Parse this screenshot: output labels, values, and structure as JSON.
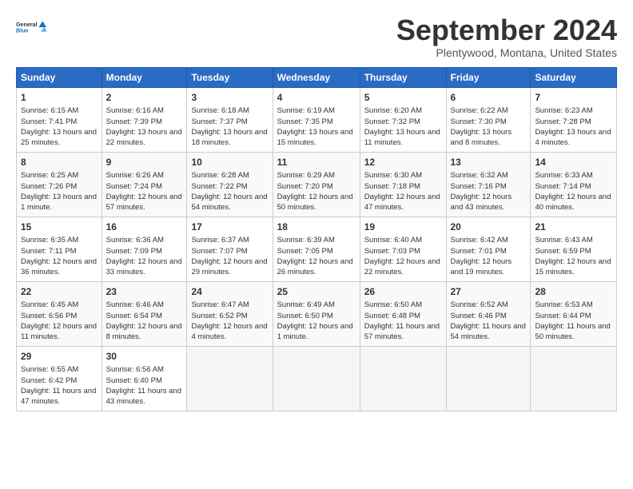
{
  "logo": {
    "general": "General",
    "blue": "Blue"
  },
  "header": {
    "month": "September 2024",
    "location": "Plentywood, Montana, United States"
  },
  "weekdays": [
    "Sunday",
    "Monday",
    "Tuesday",
    "Wednesday",
    "Thursday",
    "Friday",
    "Saturday"
  ],
  "weeks": [
    [
      {
        "day": 1,
        "sunrise": "6:15 AM",
        "sunset": "7:41 PM",
        "daylight": "13 hours and 25 minutes."
      },
      {
        "day": 2,
        "sunrise": "6:16 AM",
        "sunset": "7:39 PM",
        "daylight": "13 hours and 22 minutes."
      },
      {
        "day": 3,
        "sunrise": "6:18 AM",
        "sunset": "7:37 PM",
        "daylight": "13 hours and 18 minutes."
      },
      {
        "day": 4,
        "sunrise": "6:19 AM",
        "sunset": "7:35 PM",
        "daylight": "13 hours and 15 minutes."
      },
      {
        "day": 5,
        "sunrise": "6:20 AM",
        "sunset": "7:32 PM",
        "daylight": "13 hours and 11 minutes."
      },
      {
        "day": 6,
        "sunrise": "6:22 AM",
        "sunset": "7:30 PM",
        "daylight": "13 hours and 8 minutes."
      },
      {
        "day": 7,
        "sunrise": "6:23 AM",
        "sunset": "7:28 PM",
        "daylight": "13 hours and 4 minutes."
      }
    ],
    [
      {
        "day": 8,
        "sunrise": "6:25 AM",
        "sunset": "7:26 PM",
        "daylight": "13 hours and 1 minute."
      },
      {
        "day": 9,
        "sunrise": "6:26 AM",
        "sunset": "7:24 PM",
        "daylight": "12 hours and 57 minutes."
      },
      {
        "day": 10,
        "sunrise": "6:28 AM",
        "sunset": "7:22 PM",
        "daylight": "12 hours and 54 minutes."
      },
      {
        "day": 11,
        "sunrise": "6:29 AM",
        "sunset": "7:20 PM",
        "daylight": "12 hours and 50 minutes."
      },
      {
        "day": 12,
        "sunrise": "6:30 AM",
        "sunset": "7:18 PM",
        "daylight": "12 hours and 47 minutes."
      },
      {
        "day": 13,
        "sunrise": "6:32 AM",
        "sunset": "7:16 PM",
        "daylight": "12 hours and 43 minutes."
      },
      {
        "day": 14,
        "sunrise": "6:33 AM",
        "sunset": "7:14 PM",
        "daylight": "12 hours and 40 minutes."
      }
    ],
    [
      {
        "day": 15,
        "sunrise": "6:35 AM",
        "sunset": "7:11 PM",
        "daylight": "12 hours and 36 minutes."
      },
      {
        "day": 16,
        "sunrise": "6:36 AM",
        "sunset": "7:09 PM",
        "daylight": "12 hours and 33 minutes."
      },
      {
        "day": 17,
        "sunrise": "6:37 AM",
        "sunset": "7:07 PM",
        "daylight": "12 hours and 29 minutes."
      },
      {
        "day": 18,
        "sunrise": "6:39 AM",
        "sunset": "7:05 PM",
        "daylight": "12 hours and 26 minutes."
      },
      {
        "day": 19,
        "sunrise": "6:40 AM",
        "sunset": "7:03 PM",
        "daylight": "12 hours and 22 minutes."
      },
      {
        "day": 20,
        "sunrise": "6:42 AM",
        "sunset": "7:01 PM",
        "daylight": "12 hours and 19 minutes."
      },
      {
        "day": 21,
        "sunrise": "6:43 AM",
        "sunset": "6:59 PM",
        "daylight": "12 hours and 15 minutes."
      }
    ],
    [
      {
        "day": 22,
        "sunrise": "6:45 AM",
        "sunset": "6:56 PM",
        "daylight": "12 hours and 11 minutes."
      },
      {
        "day": 23,
        "sunrise": "6:46 AM",
        "sunset": "6:54 PM",
        "daylight": "12 hours and 8 minutes."
      },
      {
        "day": 24,
        "sunrise": "6:47 AM",
        "sunset": "6:52 PM",
        "daylight": "12 hours and 4 minutes."
      },
      {
        "day": 25,
        "sunrise": "6:49 AM",
        "sunset": "6:50 PM",
        "daylight": "12 hours and 1 minute."
      },
      {
        "day": 26,
        "sunrise": "6:50 AM",
        "sunset": "6:48 PM",
        "daylight": "11 hours and 57 minutes."
      },
      {
        "day": 27,
        "sunrise": "6:52 AM",
        "sunset": "6:46 PM",
        "daylight": "11 hours and 54 minutes."
      },
      {
        "day": 28,
        "sunrise": "6:53 AM",
        "sunset": "6:44 PM",
        "daylight": "11 hours and 50 minutes."
      }
    ],
    [
      {
        "day": 29,
        "sunrise": "6:55 AM",
        "sunset": "6:42 PM",
        "daylight": "11 hours and 47 minutes."
      },
      {
        "day": 30,
        "sunrise": "6:56 AM",
        "sunset": "6:40 PM",
        "daylight": "11 hours and 43 minutes."
      },
      null,
      null,
      null,
      null,
      null
    ]
  ]
}
